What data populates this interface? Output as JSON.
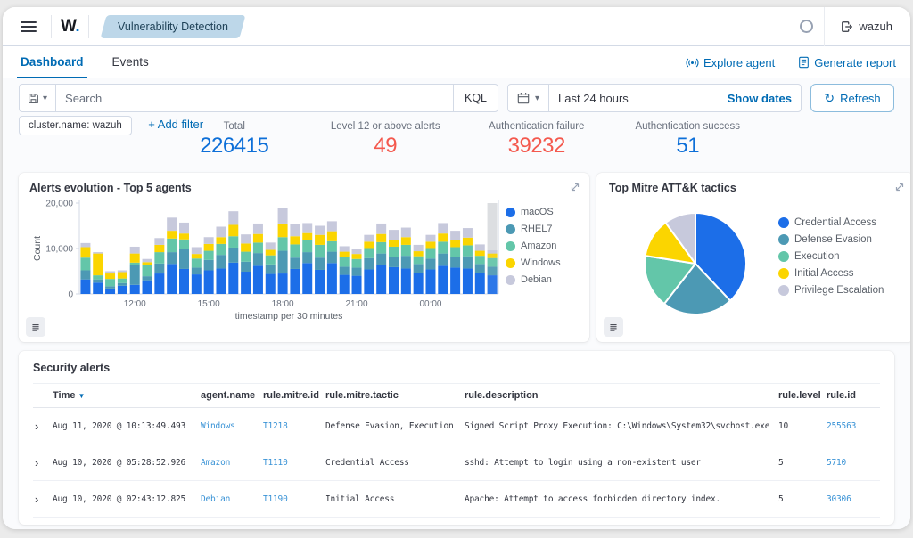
{
  "window": {
    "logo_text": "W",
    "logo_dot": ".",
    "module_badge": "Vulnerability Detection",
    "user": "wazuh"
  },
  "tabs": {
    "dashboard": "Dashboard",
    "events": "Events"
  },
  "header_actions": {
    "explore_agent": "Explore agent",
    "generate_report": "Generate report"
  },
  "search": {
    "placeholder": "Search",
    "language": "KQL",
    "time_range": "Last 24 hours",
    "show_dates": "Show dates",
    "refresh": "Refresh"
  },
  "filters": {
    "pill": "cluster.name: wazuh",
    "add_filter": "+ Add filter"
  },
  "stats": {
    "items": [
      {
        "label": "Total",
        "value": "226415",
        "color": "#0d6fd8"
      },
      {
        "label": "Level 12 or above alerts",
        "value": "49",
        "color": "#f4594e"
      },
      {
        "label": "Authentication failure",
        "value": "39232",
        "color": "#f4594e"
      },
      {
        "label": "Authentication success",
        "value": "51",
        "color": "#0d6fd8"
      }
    ]
  },
  "panels": {
    "alerts_evolution_title": "Alerts evolution - Top 5 agents",
    "mitre_title": "Top Mitre ATT&K tactics",
    "security_alerts_title": "Security alerts"
  },
  "chart_data": [
    {
      "id": "alerts_evolution",
      "type": "bar",
      "stacked": true,
      "title": "Alerts evolution - Top 5 agents",
      "xlabel": "timestamp per 30 minutes",
      "ylabel": "Count",
      "ylim": [
        0,
        20000
      ],
      "yticks": [
        0,
        10000,
        20000
      ],
      "ytick_labels": [
        "0",
        "10,000",
        "20,000"
      ],
      "x_tick_labels": [
        "12:00",
        "15:00",
        "18:00",
        "21:00",
        "00:00"
      ],
      "x_tick_indices": [
        4,
        10,
        16,
        22,
        28
      ],
      "legend_position": "right",
      "grid": false,
      "series": [
        {
          "name": "macOS",
          "color": "#1c6ee8",
          "values": [
            3200,
            2500,
            1200,
            1800,
            2000,
            3000,
            4500,
            6600,
            5500,
            4300,
            5200,
            5600,
            6900,
            4900,
            6200,
            4400,
            4500,
            5500,
            6800,
            5300,
            6800,
            4200,
            4000,
            5400,
            6300,
            5900,
            5600,
            4600,
            5400,
            6200,
            5800,
            5600,
            4600,
            4100
          ]
        },
        {
          "name": "RHEL7",
          "color": "#4c99b4",
          "values": [
            2000,
            700,
            500,
            600,
            4300,
            900,
            2200,
            2600,
            4500,
            1500,
            2300,
            3000,
            3300,
            2200,
            2800,
            2100,
            5000,
            2500,
            2400,
            2700,
            2500,
            1800,
            1800,
            2500,
            2600,
            2300,
            2800,
            2000,
            2400,
            2700,
            2300,
            2700,
            2000,
            1900
          ]
        },
        {
          "name": "Amazon",
          "color": "#63c6a9",
          "values": [
            2800,
            900,
            1600,
            1000,
            600,
            2400,
            2500,
            3000,
            2000,
            2000,
            2000,
            2400,
            2500,
            2200,
            2300,
            2000,
            3000,
            2900,
            2600,
            2800,
            2300,
            2100,
            1900,
            2200,
            2500,
            2200,
            2400,
            1700,
            2300,
            2600,
            2200,
            2400,
            1800,
            1900
          ]
        },
        {
          "name": "Windows",
          "color": "#fbd500",
          "values": [
            2300,
            4800,
            1200,
            1400,
            2000,
            700,
            1600,
            1700,
            1300,
            1000,
            1500,
            1500,
            2500,
            1800,
            1900,
            1200,
            3000,
            1800,
            1600,
            2200,
            2200,
            1200,
            1100,
            1400,
            1800,
            1500,
            1700,
            1100,
            1400,
            1800,
            1500,
            1700,
            1100,
            1000
          ]
        },
        {
          "name": "Debian",
          "color": "#c7c9dc",
          "values": [
            900,
            300,
            500,
            400,
            1500,
            700,
            1500,
            2900,
            2400,
            1500,
            1500,
            2300,
            3000,
            2000,
            2300,
            1600,
            3500,
            2700,
            2200,
            2000,
            2200,
            1200,
            1000,
            1500,
            2300,
            2200,
            2100,
            1400,
            1500,
            2300,
            2100,
            2100,
            1400,
            700
          ]
        }
      ],
      "partial_bucket": {
        "index": 33,
        "value": 20000,
        "color": "#dcdee1"
      }
    },
    {
      "id": "mitre_tactics",
      "type": "pie",
      "title": "Top Mitre ATT&K tactics",
      "labels": [
        "Credential Access",
        "Defense Evasion",
        "Execution",
        "Initial Access",
        "Privilege Escalation"
      ],
      "values": [
        38,
        22.5,
        17,
        12.5,
        10
      ],
      "colors": [
        "#1c6ee8",
        "#4c99b4",
        "#63c6a9",
        "#fbd500",
        "#c7c9dc"
      ],
      "legend_position": "right"
    }
  ],
  "table": {
    "columns": [
      "Time",
      "agent.name",
      "rule.mitre.id",
      "rule.mitre.tactic",
      "rule.description",
      "rule.level",
      "rule.id"
    ],
    "rows": [
      {
        "time": "Aug 11, 2020 @ 10:13:49.493",
        "agent": "Windows",
        "mitre_id": "T1218",
        "tactic": "Defense Evasion, Execution",
        "description": "Signed Script Proxy Execution: C:\\Windows\\System32\\svchost.exe",
        "level": "10",
        "rule_id": "255563"
      },
      {
        "time": "Aug 10, 2020 @ 05:28:52.926",
        "agent": "Amazon",
        "mitre_id": "T1110",
        "tactic": "Credential Access",
        "description": "sshd: Attempt to login using a non-existent user",
        "level": "5",
        "rule_id": "5710"
      },
      {
        "time": "Aug 10, 2020 @ 02:43:12.825",
        "agent": "Debian",
        "mitre_id": "T1190",
        "tactic": "Initial Access",
        "description": "Apache: Attempt to access forbidden directory index.",
        "level": "5",
        "rule_id": "30306"
      }
    ]
  }
}
